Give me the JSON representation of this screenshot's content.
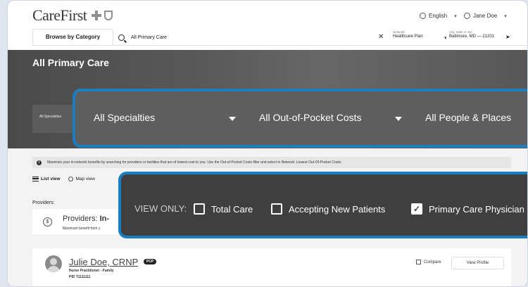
{
  "brand": {
    "logo_text": "CareFirst"
  },
  "header": {
    "language": "English",
    "user": "Jane Doe",
    "browse_label": "Browse by Category",
    "search_value": "All Primary Care",
    "clear_symbol": "✕",
    "network_label": "Network:",
    "network_value": "Healthcare Plan",
    "location_label": "City, state or zip:",
    "location_value": "Baltimore, MD — 21201"
  },
  "hero": {
    "title": "All Primary Care",
    "small_specialties": "All Specialties",
    "filters": [
      "All Specialties",
      "All Out-of-Pocket Costs",
      "All People & Places"
    ]
  },
  "info": {
    "icon": "i",
    "message": "Maximize your in-network benefits by searching for providers or facilities that are of lowest cost to you. Use the Out-of-Pocket Costs filter and select in Network: Lowest Out-Of-Pocket Costs."
  },
  "views": {
    "list": "List view",
    "map": "Map view"
  },
  "providers": {
    "label": "Providers:",
    "card_title_prefix": "Providers: ",
    "card_title_bold": "In-",
    "card_sub": "Maximum benefit from y",
    "dollar": "$"
  },
  "view_only": {
    "label": "VIEW ONLY:",
    "options": [
      {
        "label": "Total Care",
        "checked": false
      },
      {
        "label": "Accepting New Patients",
        "checked": false
      },
      {
        "label": "Primary Care Physician",
        "checked": true
      }
    ],
    "check_glyph": "✓"
  },
  "doctor": {
    "name": "Julie Doe, CRNP",
    "badge": "PCP",
    "role": "Nurse Practitioner - Family",
    "pid": "PID T1111111",
    "compare": "Compare",
    "view_profile": "View Profile"
  },
  "colors": {
    "highlight": "#1a7fc1",
    "hero_bg": "#5c5c5c"
  },
  "icons": [
    "globe-icon",
    "user-icon",
    "search-icon",
    "close-icon",
    "location-arrow-icon",
    "info-icon",
    "list-icon",
    "map-pin-icon",
    "dollar-icon",
    "checkbox-icon"
  ]
}
